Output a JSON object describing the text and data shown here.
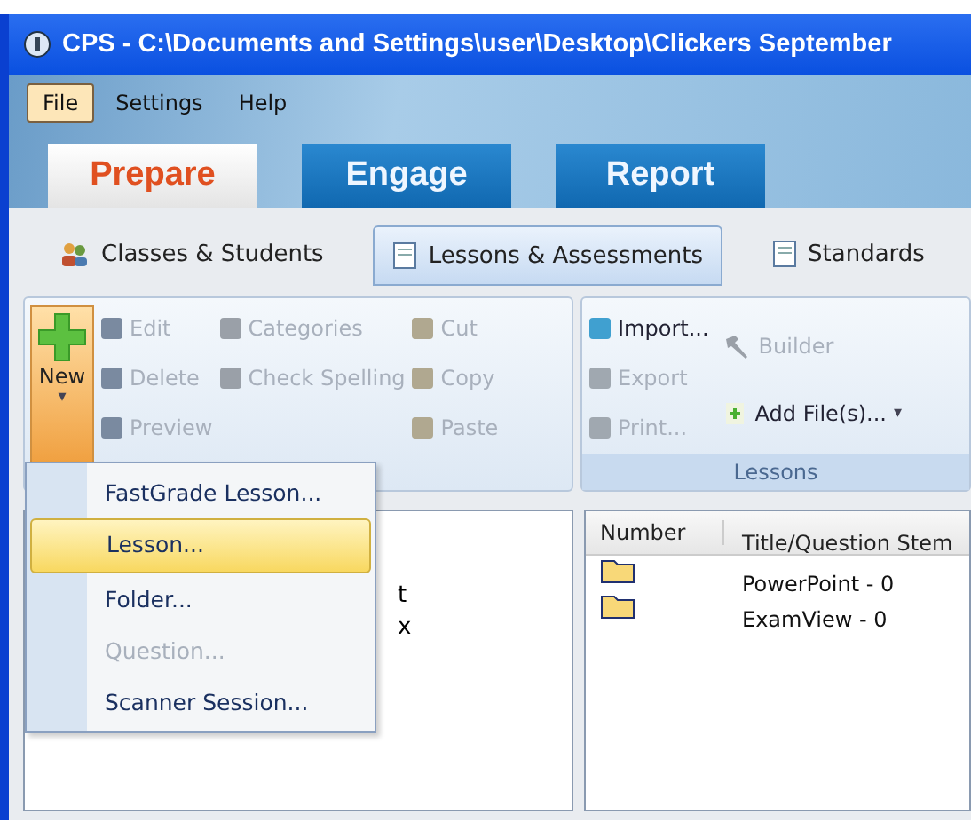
{
  "window": {
    "title": "CPS - C:\\Documents and Settings\\user\\Desktop\\Clickers September"
  },
  "menu_bar": [
    {
      "label": "File",
      "selected": true
    },
    {
      "label": "Settings",
      "selected": false
    },
    {
      "label": "Help",
      "selected": false
    }
  ],
  "main_tabs": [
    {
      "label": "Prepare",
      "selected": true
    },
    {
      "label": "Engage",
      "selected": false
    },
    {
      "label": "Report",
      "selected": false
    }
  ],
  "sub_tabs": [
    {
      "label": "Classes & Students",
      "selected": false
    },
    {
      "label": "Lessons & Assessments",
      "selected": true
    },
    {
      "label": "Standards",
      "selected": false
    }
  ],
  "ribbon": {
    "new_button": {
      "label": "New",
      "caret": "▾"
    },
    "columns": [
      [
        {
          "label": "Edit",
          "disabled": true
        },
        {
          "label": "Delete",
          "disabled": true
        },
        {
          "label": "Preview",
          "disabled": true
        }
      ],
      [
        {
          "label": "Categories",
          "disabled": true
        },
        {
          "label": "Check Spelling",
          "disabled": true
        }
      ],
      [
        {
          "label": "Cut",
          "disabled": true
        },
        {
          "label": "Copy",
          "disabled": true
        },
        {
          "label": "Paste",
          "disabled": true
        }
      ]
    ],
    "lessons_group": {
      "label": "Lessons",
      "actions": [
        {
          "label": "Import...",
          "disabled": false
        },
        {
          "label": "Export",
          "disabled": true
        },
        {
          "label": "Print...",
          "disabled": true
        }
      ],
      "builder": {
        "label": "Builder",
        "disabled": true
      },
      "add_files": {
        "label": "Add File(s)...",
        "caret": "▾",
        "disabled": false
      }
    }
  },
  "tree": {
    "items": [
      "t",
      "x"
    ]
  },
  "table": {
    "columns": [
      "Number",
      "Title/Question Stem"
    ],
    "rows": [
      {
        "title": "PowerPoint  -  0"
      },
      {
        "title": "ExamView  -  0"
      }
    ]
  },
  "dropdown": [
    {
      "label": "FastGrade Lesson...",
      "selected": false,
      "disabled": false
    },
    {
      "label": "Lesson...",
      "selected": true,
      "disabled": false
    },
    {
      "label": "Folder...",
      "selected": false,
      "disabled": false
    },
    {
      "label": "Question...",
      "selected": false,
      "disabled": true
    },
    {
      "label": "Scanner Session...",
      "selected": false,
      "disabled": false
    }
  ]
}
